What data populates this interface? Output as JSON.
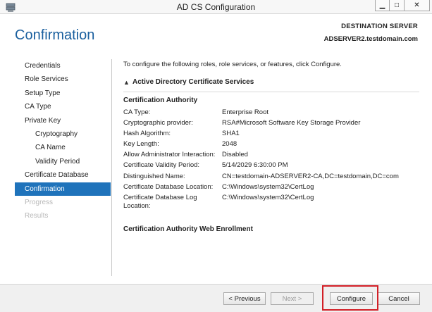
{
  "window": {
    "title": "AD CS Configuration",
    "icon": "server-icon",
    "min_glyph": "▁",
    "max_glyph": "□",
    "close_glyph": "✕"
  },
  "header": {
    "page_title": "Confirmation",
    "destination_label": "DESTINATION SERVER",
    "destination_server": "ADSERVER2.testdomain.com"
  },
  "nav": {
    "items": [
      {
        "label": "Credentials",
        "level": 0,
        "state": "normal"
      },
      {
        "label": "Role Services",
        "level": 0,
        "state": "normal"
      },
      {
        "label": "Setup Type",
        "level": 0,
        "state": "normal"
      },
      {
        "label": "CA Type",
        "level": 0,
        "state": "normal"
      },
      {
        "label": "Private Key",
        "level": 0,
        "state": "normal"
      },
      {
        "label": "Cryptography",
        "level": 1,
        "state": "normal"
      },
      {
        "label": "CA Name",
        "level": 1,
        "state": "normal"
      },
      {
        "label": "Validity Period",
        "level": 1,
        "state": "normal"
      },
      {
        "label": "Certificate Database",
        "level": 0,
        "state": "normal"
      },
      {
        "label": "Confirmation",
        "level": 0,
        "state": "active"
      },
      {
        "label": "Progress",
        "level": 0,
        "state": "disabled"
      },
      {
        "label": "Results",
        "level": 0,
        "state": "disabled"
      }
    ],
    "active_color": "#1f73bb"
  },
  "content": {
    "intro": "To configure the following roles, role services, or features, click Configure.",
    "section_caret": "▲",
    "section_title": "Active Directory Certificate Services",
    "ca_heading": "Certification Authority",
    "properties": [
      {
        "key": "CA Type:",
        "value": "Enterprise Root"
      },
      {
        "key": "Cryptographic provider:",
        "value": "RSA#Microsoft Software Key Storage Provider"
      },
      {
        "key": "Hash Algorithm:",
        "value": "SHA1"
      },
      {
        "key": "Key Length:",
        "value": "2048"
      },
      {
        "key": "Allow Administrator Interaction:",
        "value": "Disabled"
      },
      {
        "key": "Certificate Validity Period:",
        "value": "5/14/2029 6:30:00 PM"
      },
      {
        "key": "Distinguished Name:",
        "value": "CN=testdomain-ADSERVER2-CA,DC=testdomain,DC=com"
      },
      {
        "key": "Certificate Database Location:",
        "value": "C:\\Windows\\system32\\CertLog"
      },
      {
        "key": "Certificate Database Log Location:",
        "value": "C:\\Windows\\system32\\CertLog"
      }
    ],
    "web_enrollment_heading": "Certification Authority Web Enrollment"
  },
  "footer": {
    "previous_label": "< Previous",
    "next_label": "Next >",
    "configure_label": "Configure",
    "cancel_label": "Cancel",
    "highlight_color": "#d21f26"
  }
}
